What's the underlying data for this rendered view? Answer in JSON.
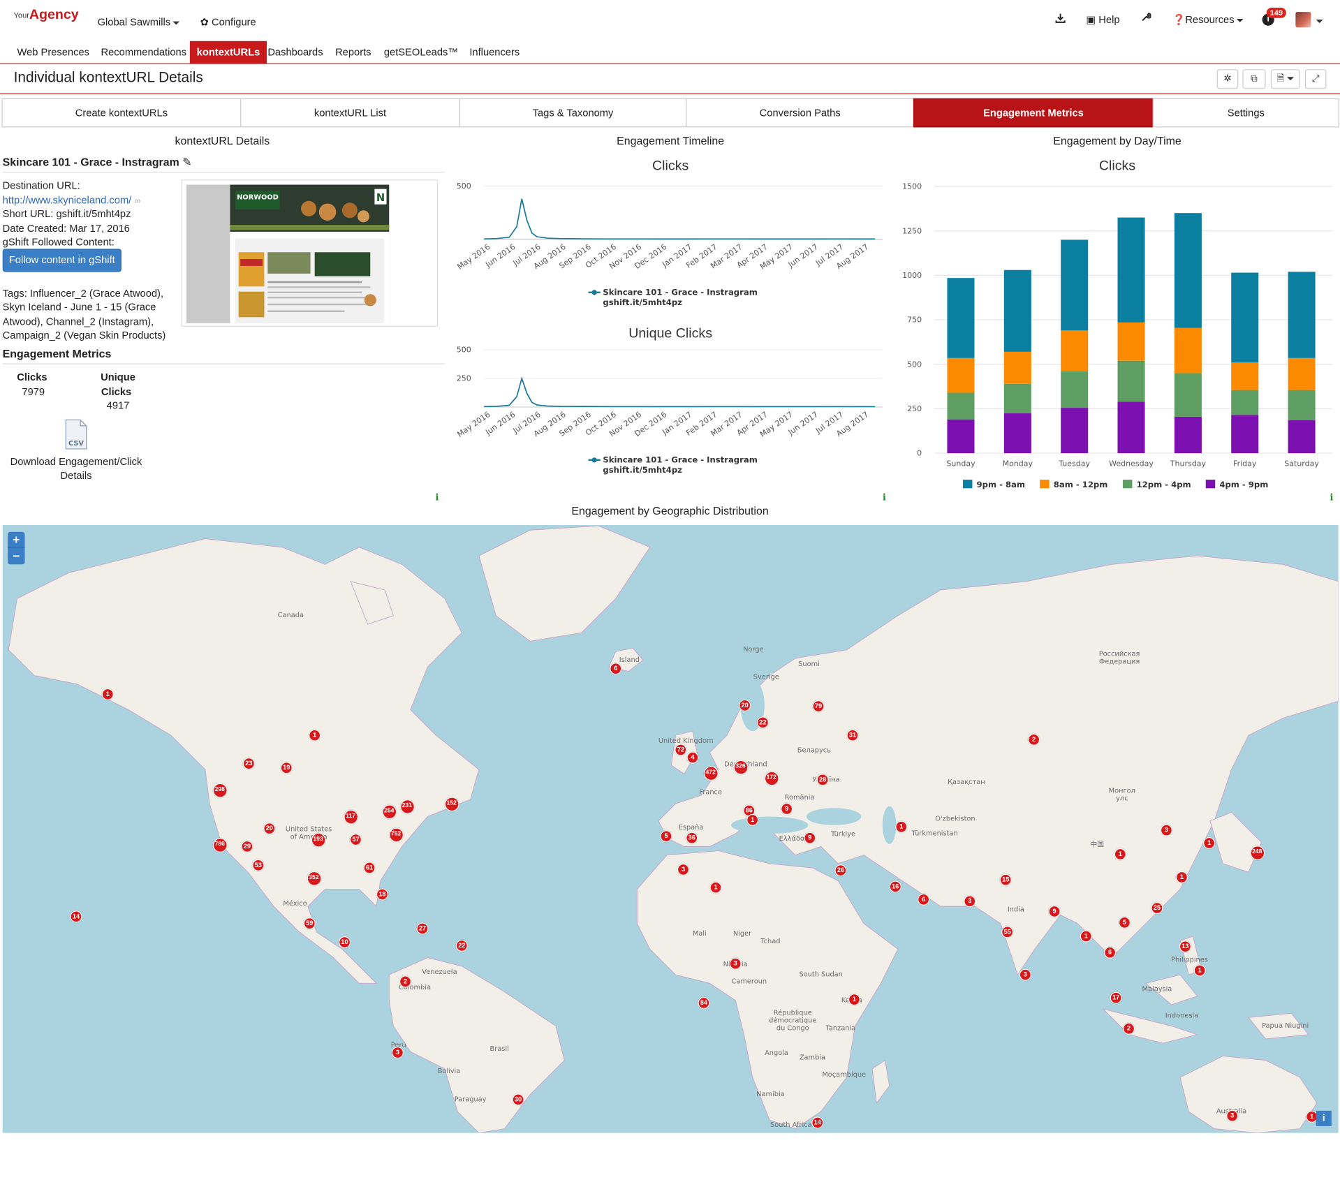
{
  "app": {
    "logo_small": "Your",
    "logo_main": "Agency",
    "account": "Global Sawmills",
    "configure": "Configure",
    "help": "Help",
    "resources": "Resources",
    "notifications": "149"
  },
  "menu": [
    "Web Presences",
    "Recommendations",
    "kontextURLs",
    "Dashboards",
    "Reports",
    "getSEOLeads™",
    "Influencers"
  ],
  "menu_active": "kontextURLs",
  "page": {
    "title": "Individual kontextURL Details"
  },
  "tabs": [
    "Create kontextURLs",
    "kontextURL List",
    "Tags & Taxonomy",
    "Conversion Paths",
    "Engagement Metrics",
    "Settings"
  ],
  "tab_active": "Engagement Metrics",
  "sections": {
    "details": "kontextURL Details",
    "timeline": "Engagement Timeline",
    "daytime": "Engagement by Day/Time",
    "geo": "Engagement by Geographic Distribution"
  },
  "details": {
    "name": "Skincare 101 - Grace - Instragram",
    "dest_label": "Destination URL:",
    "dest_url": "http://www.skyniceland.com/",
    "short_url": "Short URL: gshift.it/5mht4pz",
    "date_created": "Date Created: Mar 17, 2016",
    "followed": "gShift Followed Content:",
    "follow_button": "Follow content in gShift",
    "tags": "Tags: Influencer_2 (Grace Atwood), Skyn Iceland - June 1 - 15 (Grace Atwood), Channel_2 (Instagram), Campaign_2 (Vegan Skin Products)",
    "metrics_title": "Engagement Metrics",
    "clicks_label": "Clicks",
    "clicks_value": "7979",
    "unique_label_1": "Unique",
    "unique_label_2": "Clicks",
    "unique_value": "4917",
    "csv_label": "CSV",
    "download_label": "Download Engagement/Click Details"
  },
  "chart_data": [
    {
      "type": "line",
      "title": "Clicks",
      "y_ticks": [
        500
      ],
      "ylim": [
        0,
        600
      ],
      "x_tick_labels": [
        "May 2016",
        "Jun 2016",
        "Jul 2016",
        "Aug 2016",
        "Sep 2016",
        "Oct 2016",
        "Nov 2016",
        "Dec 2016",
        "Jan 2017",
        "Feb 2017",
        "Mar 2017",
        "Apr 2017",
        "May 2017",
        "Jun 2017",
        "Jul 2017",
        "Aug 2017"
      ],
      "series": [
        {
          "name": "Skincare 101 - Grace - Instragram gshift.it/5mht4pz",
          "color": "#1a7a9a"
        }
      ],
      "x_months": [
        0,
        0.5,
        1,
        1.3,
        1.5,
        1.7,
        1.9,
        2.1,
        2.5,
        3,
        4,
        5,
        6,
        7,
        8,
        9,
        10,
        11,
        12,
        13,
        14,
        15,
        15.5
      ],
      "values": [
        5,
        8,
        20,
        120,
        380,
        180,
        60,
        25,
        12,
        8,
        6,
        5,
        5,
        4,
        4,
        5,
        5,
        4,
        4,
        4,
        5,
        4,
        4
      ],
      "grid": false
    },
    {
      "type": "line",
      "title": "Unique Clicks",
      "y_ticks": [
        250,
        500
      ],
      "ylim": [
        0,
        560
      ],
      "x_tick_labels": [
        "May 2016",
        "Jun 2016",
        "Jul 2016",
        "Aug 2016",
        "Sep 2016",
        "Oct 2016",
        "Nov 2016",
        "Dec 2016",
        "Jan 2017",
        "Feb 2017",
        "Mar 2017",
        "Apr 2017",
        "May 2017",
        "Jun 2017",
        "Jul 2017",
        "Aug 2017"
      ],
      "series": [
        {
          "name": "Skincare 101 - Grace - Instragram gshift.it/5mht4pz",
          "color": "#1a7a9a"
        }
      ],
      "x_months": [
        0,
        0.5,
        1,
        1.3,
        1.5,
        1.7,
        1.9,
        2.1,
        2.5,
        3,
        4,
        5,
        6,
        7,
        8,
        9,
        10,
        11,
        12,
        13,
        14,
        15,
        15.5
      ],
      "values": [
        4,
        6,
        15,
        90,
        250,
        120,
        40,
        18,
        9,
        6,
        5,
        4,
        4,
        3,
        3,
        4,
        4,
        3,
        3,
        3,
        4,
        3,
        3
      ],
      "grid": false
    },
    {
      "type": "bar",
      "stacked": true,
      "title": "Clicks",
      "categories": [
        "Sunday",
        "Monday",
        "Tuesday",
        "Wednesday",
        "Thursday",
        "Friday",
        "Saturday"
      ],
      "y_ticks": [
        0,
        250,
        500,
        750,
        1000,
        1250,
        1500
      ],
      "ylim": [
        0,
        1500
      ],
      "series": [
        {
          "name": "4pm - 9pm",
          "color": "#7b0fb0",
          "values": [
            190,
            225,
            255,
            290,
            205,
            215,
            185
          ]
        },
        {
          "name": "12pm - 4pm",
          "color": "#5f9e62",
          "values": [
            150,
            165,
            205,
            230,
            245,
            140,
            170
          ]
        },
        {
          "name": "8am - 12pm",
          "color": "#fb8a00",
          "values": [
            195,
            180,
            230,
            215,
            255,
            155,
            180
          ]
        },
        {
          "name": "9pm - 8am",
          "color": "#0a7fa0",
          "values": [
            450,
            460,
            510,
            590,
            645,
            505,
            485
          ]
        }
      ],
      "legend": "bottom"
    }
  ],
  "map": {
    "zoom_in": "+",
    "zoom_out": "−",
    "info": "i",
    "country_labels": [
      {
        "t": "Canada",
        "x": 340,
        "y": 720
      },
      {
        "t": "Island",
        "x": 736,
        "y": 772
      },
      {
        "t": "Norge",
        "x": 881,
        "y": 760
      },
      {
        "t": "Sverige",
        "x": 896,
        "y": 792
      },
      {
        "t": "Suomi",
        "x": 946,
        "y": 777
      },
      {
        "t": "Российская\nФедерация",
        "x": 1309,
        "y": 765
      },
      {
        "t": "United Kingdom",
        "x": 802,
        "y": 867
      },
      {
        "t": "Беларусь",
        "x": 952,
        "y": 878
      },
      {
        "t": "Deutschland",
        "x": 872,
        "y": 894
      },
      {
        "t": "France",
        "x": 831,
        "y": 927
      },
      {
        "t": "Україна",
        "x": 966,
        "y": 912
      },
      {
        "t": "Қазақстан",
        "x": 1130,
        "y": 915
      },
      {
        "t": "Монгол\nулс",
        "x": 1312,
        "y": 925
      },
      {
        "t": "România",
        "x": 935,
        "y": 933
      },
      {
        "t": "España",
        "x": 808,
        "y": 968
      },
      {
        "t": "Türkiye",
        "x": 986,
        "y": 976
      },
      {
        "t": "Ελλάδα",
        "x": 926,
        "y": 981
      },
      {
        "t": "O'zbekiston",
        "x": 1117,
        "y": 958
      },
      {
        "t": "Türkmenistan",
        "x": 1093,
        "y": 975
      },
      {
        "t": "United States\nof America",
        "x": 361,
        "y": 970
      },
      {
        "t": "中国",
        "x": 1283,
        "y": 987
      },
      {
        "t": "México",
        "x": 345,
        "y": 1057
      },
      {
        "t": "India",
        "x": 1188,
        "y": 1064
      },
      {
        "t": "Mali",
        "x": 818,
        "y": 1092
      },
      {
        "t": "Niger",
        "x": 868,
        "y": 1092
      },
      {
        "t": "Tchad",
        "x": 901,
        "y": 1101
      },
      {
        "t": "Venezuela",
        "x": 514,
        "y": 1137
      },
      {
        "t": "Colombia",
        "x": 485,
        "y": 1155
      },
      {
        "t": "Nigeria",
        "x": 860,
        "y": 1128
      },
      {
        "t": "South Sudan",
        "x": 960,
        "y": 1140
      },
      {
        "t": "Cameroun",
        "x": 876,
        "y": 1148
      },
      {
        "t": "Philippines",
        "x": 1391,
        "y": 1123
      },
      {
        "t": "Malaysia",
        "x": 1353,
        "y": 1157
      },
      {
        "t": "Indonesia",
        "x": 1382,
        "y": 1188
      },
      {
        "t": "Kenya",
        "x": 996,
        "y": 1170
      },
      {
        "t": "République\ndémocratique\ndu Congo",
        "x": 927,
        "y": 1185
      },
      {
        "t": "Papua Niugini",
        "x": 1503,
        "y": 1200
      },
      {
        "t": "Tanzania",
        "x": 983,
        "y": 1203
      },
      {
        "t": "Brasil",
        "x": 584,
        "y": 1227
      },
      {
        "t": "Perú",
        "x": 466,
        "y": 1223
      },
      {
        "t": "Angola",
        "x": 908,
        "y": 1232
      },
      {
        "t": "Zambia",
        "x": 950,
        "y": 1237
      },
      {
        "t": "Bolivia",
        "x": 525,
        "y": 1253
      },
      {
        "t": "Moçambique",
        "x": 987,
        "y": 1257
      },
      {
        "t": "Namibia",
        "x": 901,
        "y": 1280
      },
      {
        "t": "Paraguay",
        "x": 550,
        "y": 1286
      },
      {
        "t": "Australia",
        "x": 1440,
        "y": 1300
      },
      {
        "t": "South Africa",
        "x": 925,
        "y": 1316
      }
    ],
    "markers": [
      {
        "v": "1",
        "x": 126,
        "y": 812
      },
      {
        "v": "1",
        "x": 368,
        "y": 860
      },
      {
        "v": "23",
        "x": 291,
        "y": 893
      },
      {
        "v": "19",
        "x": 335,
        "y": 898
      },
      {
        "v": "298",
        "x": 257,
        "y": 924
      },
      {
        "v": "152",
        "x": 528,
        "y": 940
      },
      {
        "v": "231",
        "x": 476,
        "y": 943
      },
      {
        "v": "254",
        "x": 455,
        "y": 949
      },
      {
        "v": "117",
        "x": 410,
        "y": 955
      },
      {
        "v": "20",
        "x": 315,
        "y": 969
      },
      {
        "v": "193",
        "x": 372,
        "y": 982
      },
      {
        "v": "57",
        "x": 416,
        "y": 982
      },
      {
        "v": "752",
        "x": 463,
        "y": 976
      },
      {
        "v": "786",
        "x": 257,
        "y": 988
      },
      {
        "v": "29",
        "x": 289,
        "y": 990
      },
      {
        "v": "53",
        "x": 302,
        "y": 1012
      },
      {
        "v": "61",
        "x": 432,
        "y": 1015
      },
      {
        "v": "352",
        "x": 367,
        "y": 1027
      },
      {
        "v": "18",
        "x": 447,
        "y": 1046
      },
      {
        "v": "14",
        "x": 89,
        "y": 1072
      },
      {
        "v": "59",
        "x": 362,
        "y": 1080
      },
      {
        "v": "27",
        "x": 494,
        "y": 1086
      },
      {
        "v": "10",
        "x": 403,
        "y": 1102
      },
      {
        "v": "22",
        "x": 540,
        "y": 1106
      },
      {
        "v": "2",
        "x": 474,
        "y": 1148
      },
      {
        "v": "3",
        "x": 465,
        "y": 1231
      },
      {
        "v": "30",
        "x": 606,
        "y": 1286
      },
      {
        "v": "84",
        "x": 823,
        "y": 1173
      },
      {
        "v": "6",
        "x": 720,
        "y": 782
      },
      {
        "v": "20",
        "x": 871,
        "y": 825
      },
      {
        "v": "79",
        "x": 957,
        "y": 826
      },
      {
        "v": "22",
        "x": 892,
        "y": 845
      },
      {
        "v": "31",
        "x": 997,
        "y": 860
      },
      {
        "v": "72",
        "x": 796,
        "y": 877
      },
      {
        "v": "4",
        "x": 810,
        "y": 886
      },
      {
        "v": "326",
        "x": 866,
        "y": 897
      },
      {
        "v": "472",
        "x": 831,
        "y": 904
      },
      {
        "v": "172",
        "x": 902,
        "y": 910
      },
      {
        "v": "28",
        "x": 962,
        "y": 912
      },
      {
        "v": "9",
        "x": 920,
        "y": 946
      },
      {
        "v": "86",
        "x": 876,
        "y": 948
      },
      {
        "v": "1",
        "x": 880,
        "y": 959
      },
      {
        "v": "1",
        "x": 1054,
        "y": 967
      },
      {
        "v": "5",
        "x": 779,
        "y": 978
      },
      {
        "v": "36",
        "x": 809,
        "y": 980
      },
      {
        "v": "9",
        "x": 947,
        "y": 980
      },
      {
        "v": "3",
        "x": 799,
        "y": 1017
      },
      {
        "v": "1",
        "x": 837,
        "y": 1038
      },
      {
        "v": "26",
        "x": 983,
        "y": 1018
      },
      {
        "v": "15",
        "x": 1176,
        "y": 1029
      },
      {
        "v": "16",
        "x": 1047,
        "y": 1037
      },
      {
        "v": "6",
        "x": 1080,
        "y": 1052
      },
      {
        "v": "3",
        "x": 1134,
        "y": 1054
      },
      {
        "v": "9",
        "x": 1233,
        "y": 1066
      },
      {
        "v": "55",
        "x": 1178,
        "y": 1090
      },
      {
        "v": "3",
        "x": 1199,
        "y": 1140
      },
      {
        "v": "3",
        "x": 860,
        "y": 1127
      },
      {
        "v": "1",
        "x": 999,
        "y": 1169
      },
      {
        "v": "2",
        "x": 1209,
        "y": 865
      },
      {
        "v": "3",
        "x": 1364,
        "y": 971
      },
      {
        "v": "1",
        "x": 1414,
        "y": 986
      },
      {
        "v": "248",
        "x": 1470,
        "y": 997
      },
      {
        "v": "1",
        "x": 1310,
        "y": 999
      },
      {
        "v": "1",
        "x": 1382,
        "y": 1026
      },
      {
        "v": "25",
        "x": 1353,
        "y": 1062
      },
      {
        "v": "5",
        "x": 1315,
        "y": 1079
      },
      {
        "v": "1",
        "x": 1270,
        "y": 1095
      },
      {
        "v": "6",
        "x": 1298,
        "y": 1114
      },
      {
        "v": "13",
        "x": 1386,
        "y": 1107
      },
      {
        "v": "1",
        "x": 1403,
        "y": 1135
      },
      {
        "v": "17",
        "x": 1305,
        "y": 1167
      },
      {
        "v": "2",
        "x": 1320,
        "y": 1203
      },
      {
        "v": "3",
        "x": 1441,
        "y": 1305
      },
      {
        "v": "1",
        "x": 1534,
        "y": 1306
      },
      {
        "v": "14",
        "x": 956,
        "y": 1313
      }
    ]
  }
}
